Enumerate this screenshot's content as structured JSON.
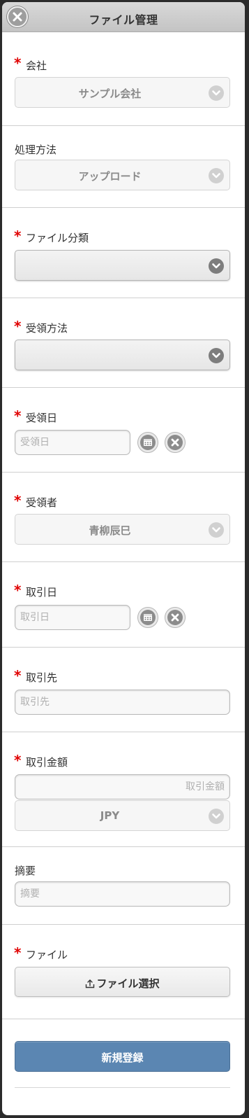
{
  "header": {
    "title": "ファイル管理"
  },
  "required_mark": "*",
  "fields": {
    "company": {
      "label": "会社",
      "value": "サンプル会社"
    },
    "process_method": {
      "label": "処理方法",
      "value": "アップロード"
    },
    "file_category": {
      "label": "ファイル分類",
      "value": ""
    },
    "receipt_method": {
      "label": "受領方法",
      "value": ""
    },
    "receipt_date": {
      "label": "受領日",
      "placeholder": "受領日"
    },
    "recipient": {
      "label": "受領者",
      "value": "青柳辰巳"
    },
    "transaction_date": {
      "label": "取引日",
      "placeholder": "取引日"
    },
    "counterparty": {
      "label": "取引先",
      "placeholder": "取引先"
    },
    "amount": {
      "label": "取引金額",
      "placeholder": "取引金額",
      "currency": "JPY"
    },
    "summary": {
      "label": "摘要",
      "placeholder": "摘要"
    },
    "file": {
      "label": "ファイル",
      "button": "ファイル選択"
    }
  },
  "actions": {
    "submit": "新規登録"
  },
  "colors": {
    "required": "#e00000",
    "primary_button": "#5b86b2",
    "header_bg": "#c8c8c8"
  },
  "icons": [
    "close-icon",
    "chevron-down-icon",
    "calendar-icon",
    "clear-icon",
    "upload-icon"
  ]
}
